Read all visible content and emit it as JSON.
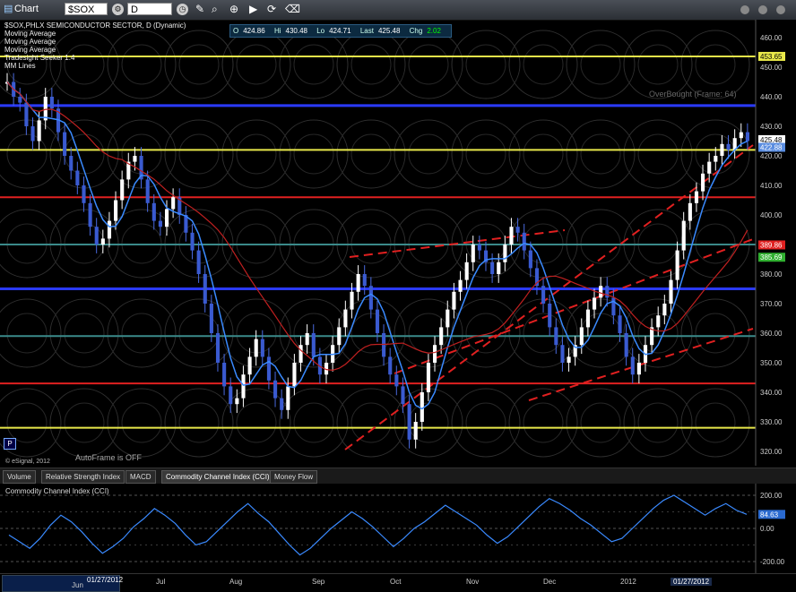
{
  "window": {
    "title": "Chart",
    "symbol": "$SOX",
    "interval": "D"
  },
  "ohlc": {
    "o_label": "O",
    "o": "424.86",
    "h_label": "Hi",
    "h": "430.48",
    "l_label": "Lo",
    "l": "424.71",
    "last_label": "Last",
    "last": "425.48",
    "chg_label": "Chg",
    "chg": "2.02"
  },
  "studies": [
    "$SOX,PHLX SEMICONDUCTOR SECTOR, D (Dynamic)",
    "Moving Average",
    "Moving Average",
    "Moving Average",
    "Tradesight Seeker 1.4",
    "MM Lines"
  ],
  "overbought": "OverBought (Frame: 64)",
  "autoframe": "AutoFrame is OFF",
  "copyright": "© eSignal, 2012",
  "p_button": "P",
  "tabs": [
    "Volume",
    "Relative Strength Index",
    "MACD",
    "Commodity Channel Index (CCI)",
    "Money Flow"
  ],
  "cci": {
    "title": "Commodity Channel Index (CCI)",
    "value": "84.63",
    "levels": [
      "200.00",
      "0.00",
      "-200.00"
    ]
  },
  "x_labels": [
    "Jul",
    "Aug",
    "Sep",
    "Oct",
    "Nov",
    "Dec",
    "2012"
  ],
  "x_date_left": "01/27/2012",
  "x_date_left_sub": "Jun",
  "x_date_right": "01/27/2012",
  "price_tags": [
    {
      "value": "453.65",
      "color": "#e8e84a"
    },
    {
      "value": "425.48",
      "color": "#ffffff"
    },
    {
      "value": "422.88",
      "color": "#5a8de0"
    },
    {
      "value": "389.86",
      "color": "#e02020"
    },
    {
      "value": "385.69",
      "color": "#30b030"
    }
  ],
  "chart_data": {
    "type": "candlestick",
    "title": "$SOX,PHLX SEMICONDUCTOR SECTOR, D (Dynamic)",
    "ylim": [
      315,
      465
    ],
    "y_ticks": [
      320,
      330,
      340,
      350,
      360,
      370,
      380,
      390,
      400,
      410,
      420,
      430,
      440,
      450,
      460
    ],
    "close": [
      445,
      440,
      438,
      430,
      425,
      432,
      440,
      436,
      428,
      420,
      415,
      410,
      404,
      396,
      390,
      392,
      398,
      405,
      412,
      418,
      420,
      412,
      404,
      398,
      396,
      402,
      406,
      400,
      394,
      388,
      380,
      370,
      360,
      350,
      342,
      336,
      338,
      346,
      352,
      358,
      352,
      344,
      338,
      334,
      342,
      350,
      356,
      360,
      352,
      346,
      350,
      356,
      362,
      368,
      374,
      380,
      376,
      368,
      360,
      352,
      346,
      342,
      336,
      324,
      330,
      340,
      350,
      356,
      362,
      368,
      374,
      378,
      384,
      390,
      388,
      384,
      380,
      384,
      390,
      396,
      394,
      388,
      382,
      376,
      370,
      362,
      356,
      350,
      352,
      356,
      362,
      368,
      372,
      376,
      372,
      366,
      360,
      352,
      346,
      350,
      356,
      362,
      366,
      370,
      378,
      388,
      398,
      404,
      408,
      414,
      418,
      420,
      424,
      422,
      426,
      428,
      425
    ],
    "horizontal_levels": [
      {
        "y": 453.65,
        "color": "#e8e84a"
      },
      {
        "y": 437,
        "color": "#2a3aff"
      },
      {
        "y": 422,
        "color": "#e8e84a"
      },
      {
        "y": 406,
        "color": "#e02020"
      },
      {
        "y": 390,
        "color": "#3a8a8a"
      },
      {
        "y": 375,
        "color": "#2a3aff"
      },
      {
        "y": 359,
        "color": "#3a8a8a"
      },
      {
        "y": 343,
        "color": "#e02020"
      },
      {
        "y": 328,
        "color": "#e8e84a"
      }
    ],
    "cci": [
      -40,
      -80,
      -120,
      -60,
      20,
      80,
      40,
      -20,
      -90,
      -150,
      -110,
      -60,
      10,
      60,
      120,
      80,
      30,
      -40,
      -100,
      -80,
      -20,
      40,
      100,
      150,
      90,
      40,
      -30,
      -100,
      -160,
      -120,
      -60,
      0,
      50,
      100,
      60,
      10,
      -50,
      -110,
      -60,
      0,
      40,
      90,
      140,
      100,
      60,
      20,
      -40,
      -90,
      -50,
      10,
      70,
      130,
      180,
      150,
      110,
      60,
      20,
      -30,
      -80,
      -60,
      0,
      60,
      120,
      170,
      200,
      160,
      120,
      80,
      120,
      150,
      110,
      84.63
    ]
  }
}
